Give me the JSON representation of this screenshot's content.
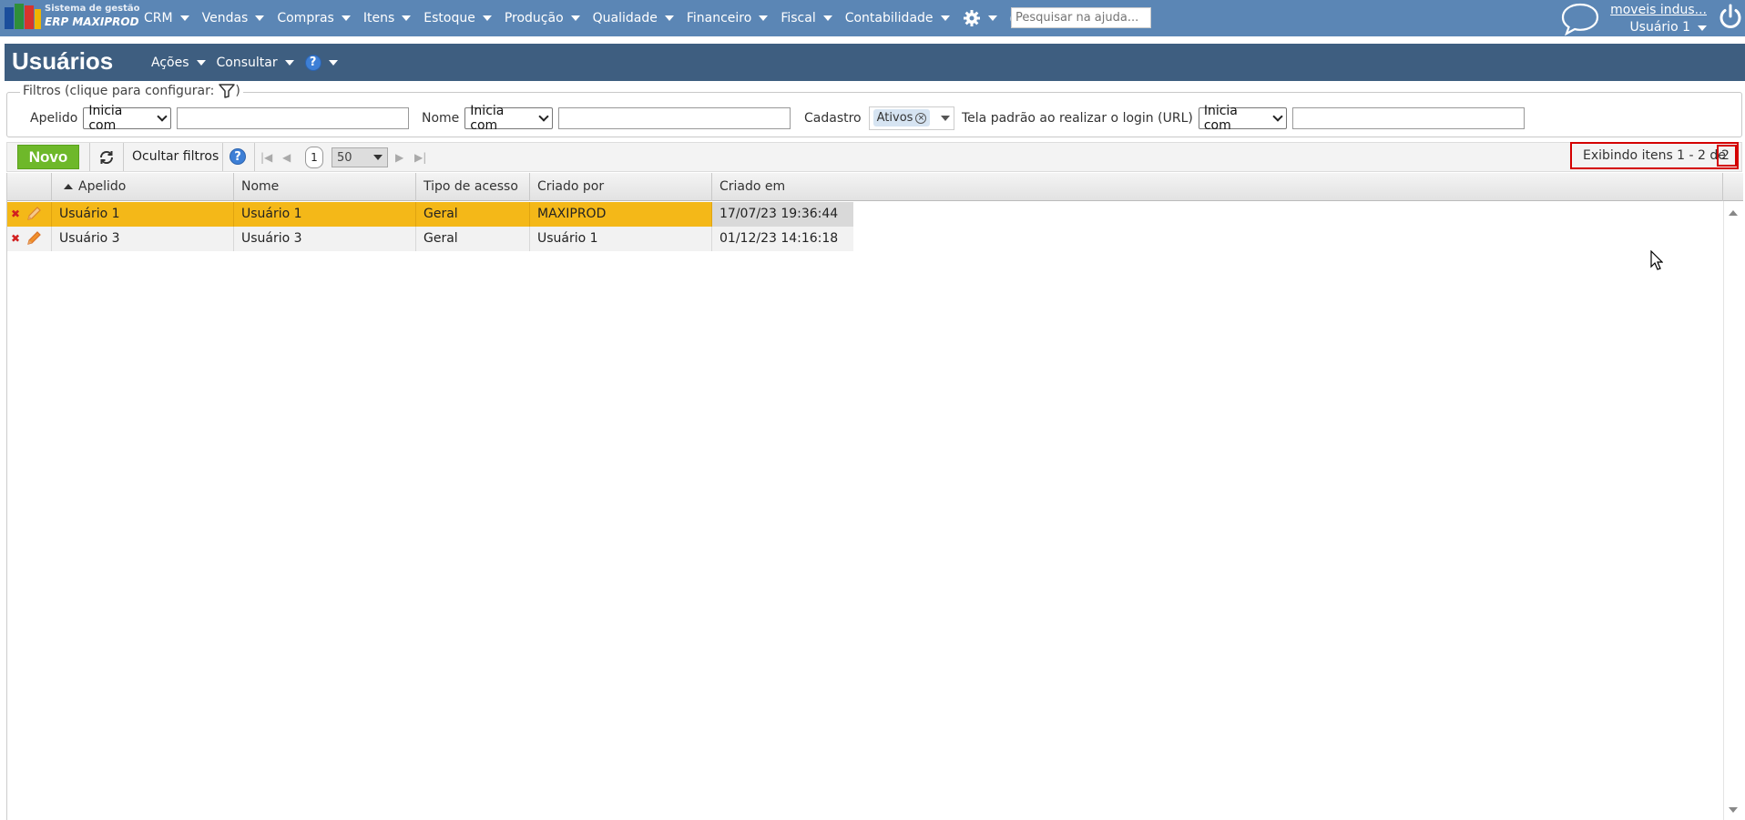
{
  "brand": {
    "line1": "Sistema de gestão",
    "line2": "ERP MAXIPROD"
  },
  "top_menu": [
    {
      "label": "CRM"
    },
    {
      "label": "Vendas"
    },
    {
      "label": "Compras"
    },
    {
      "label": "Itens"
    },
    {
      "label": "Estoque"
    },
    {
      "label": "Produção"
    },
    {
      "label": "Qualidade"
    },
    {
      "label": "Financeiro"
    },
    {
      "label": "Fiscal"
    },
    {
      "label": "Contabilidade"
    }
  ],
  "help_search": {
    "placeholder": "Pesquisar na ajuda..."
  },
  "user": {
    "company": "moveis indus...",
    "name": "Usuário 1"
  },
  "page": {
    "title": "Usuários",
    "actions_label": "Ações",
    "consult_label": "Consultar",
    "help_glyph": "?"
  },
  "filters": {
    "legend": "Filtros (clique para configurar:",
    "legend_close": ")",
    "apelido": {
      "label": "Apelido",
      "mode": "Inicia com",
      "value": ""
    },
    "nome": {
      "label": "Nome",
      "mode": "Inicia com",
      "value": ""
    },
    "cadastro": {
      "label": "Cadastro",
      "tag": "Ativos",
      "remove_glyph": "×"
    },
    "tela": {
      "label": "Tela padrão ao realizar o login (URL)",
      "mode": "Inicia com",
      "value": ""
    }
  },
  "toolbar": {
    "new_label": "Novo",
    "hide_filters_label": "Ocultar filtros",
    "help_glyph": "?",
    "current_page": "1",
    "page_size": "50",
    "first_glyph": "|◀",
    "prev_glyph": "◀",
    "next_glyph": "▶",
    "last_glyph": "▶|",
    "pager_text": "Exibindo itens 1 - 2 de",
    "pager_total": "2"
  },
  "grid": {
    "columns": [
      "Apelido",
      "Nome",
      "Tipo de acesso",
      "Criado por",
      "Criado em"
    ],
    "rows": [
      {
        "apelido": "Usuário 1",
        "nome": "Usuário 1",
        "tipo": "Geral",
        "criado_por": "MAXIPROD",
        "criado_em": "17/07/23 19:36:44"
      },
      {
        "apelido": "Usuário 3",
        "nome": "Usuário 3",
        "tipo": "Geral",
        "criado_por": "Usuário 1",
        "criado_em": "01/12/23 14:16:18"
      }
    ],
    "delete_glyph": "✖"
  },
  "colors": {
    "topbar": "#5b86b5",
    "page_header": "#3e5e80",
    "selected_row": "#f4b818",
    "new_button": "#6eb82a",
    "highlight_box": "#d40000"
  }
}
